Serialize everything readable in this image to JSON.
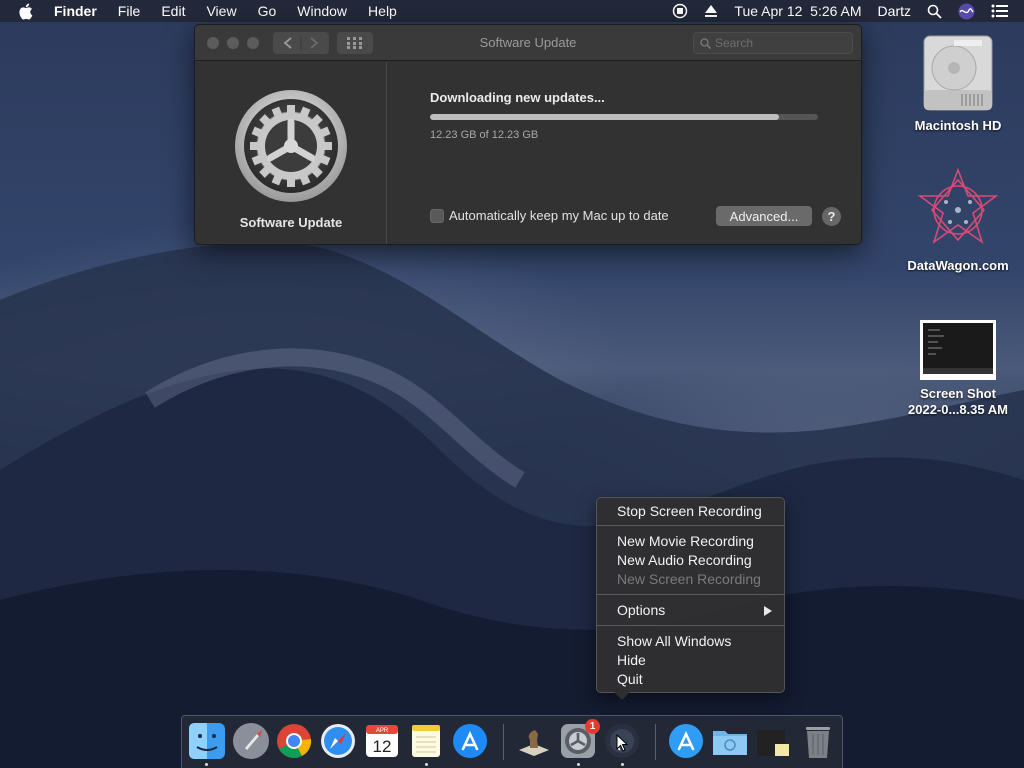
{
  "menubar": {
    "items": [
      {
        "label": "Finder",
        "bold": true
      },
      {
        "label": "File"
      },
      {
        "label": "Edit"
      },
      {
        "label": "View"
      },
      {
        "label": "Go"
      },
      {
        "label": "Window"
      },
      {
        "label": "Help"
      }
    ],
    "datetime": "Tue Apr 12  5:26 AM",
    "user": "Dartz"
  },
  "window": {
    "title": "Software Update",
    "search_placeholder": "Search",
    "sidebar_label": "Software Update",
    "status": "Downloading new updates...",
    "progress_fraction": 0.9,
    "size_text": "12.23 GB of 12.23 GB",
    "auto_update_label": "Automatically keep my Mac up to date",
    "advanced_label": "Advanced...",
    "help_label": "?"
  },
  "desktop": {
    "icons": [
      {
        "name": "macintosh-hd",
        "label": "Macintosh HD"
      },
      {
        "name": "datawagon",
        "label": "DataWagon.com"
      },
      {
        "name": "screenshot",
        "label_line1": "Screen Shot",
        "label_line2": "2022-0...8.35 AM"
      }
    ]
  },
  "context_menu": {
    "stop_screen": "Stop Screen Recording",
    "new_movie": "New Movie Recording",
    "new_audio": "New Audio Recording",
    "new_screen": "New Screen Recording",
    "options": "Options",
    "show_all": "Show All Windows",
    "hide": "Hide",
    "quit": "Quit"
  },
  "dock": {
    "calendar_month": "APR",
    "calendar_day": "12",
    "sysprefs_badge": "1"
  },
  "colors": {
    "accent_badge": "#e63b30",
    "window_bg": "#323232"
  }
}
